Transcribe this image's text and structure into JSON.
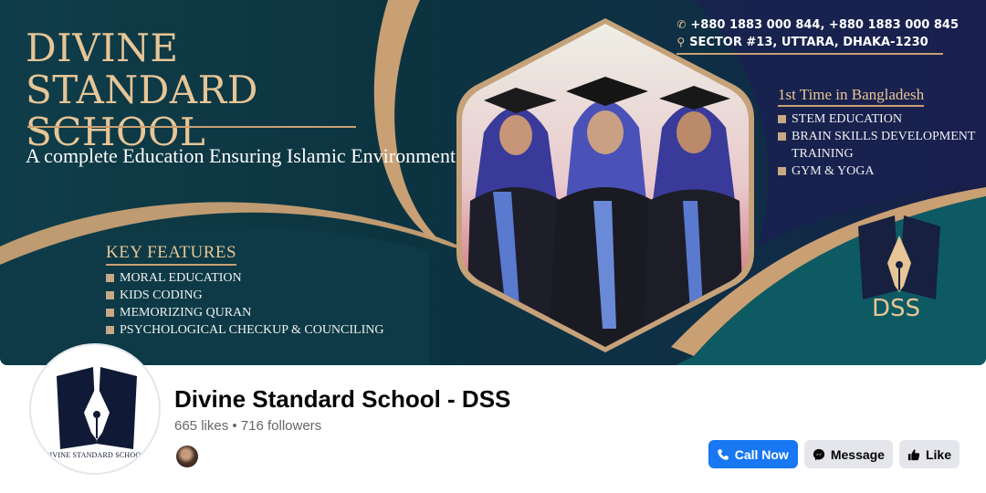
{
  "cover": {
    "school_title": "DIVINE STANDARD SCHOOL",
    "tagline": "A complete Education Ensuring Islamic Environment",
    "phone": "+880 1883 000 844, +880 1883 000 845",
    "address": "SECTOR #13, UTTARA, DHAKA-1230",
    "key_features": {
      "heading": "KEY FEATURES",
      "items": [
        "MORAL EDUCATION",
        "KIDS CODING",
        "MEMORIZING QURAN",
        "PSYCHOLOGICAL CHECKUP & COUNCILING"
      ]
    },
    "first_time": {
      "heading": "1st Time in Bangladesh",
      "items": [
        "STEM EDUCATION",
        "BRAIN SKILLS DEVELOPMENT",
        "TRAINING",
        "GYM & YOGA"
      ]
    },
    "logo_text": "DSS",
    "colors": {
      "gold": "#e7c596",
      "teal": "#0f3d49",
      "navy": "#1a1d4a"
    }
  },
  "profile": {
    "avatar_caption": "DIVINE STANDARD SCHOOL",
    "name": "Divine Standard School - DSS",
    "stats": "665 likes • 716 followers"
  },
  "actions": {
    "call_label": "Call Now",
    "message_label": "Message",
    "like_label": "Like",
    "call_icon": "phone-icon",
    "message_icon": "messenger-icon",
    "like_icon": "thumbs-up-icon",
    "accent": "#1877f2"
  }
}
